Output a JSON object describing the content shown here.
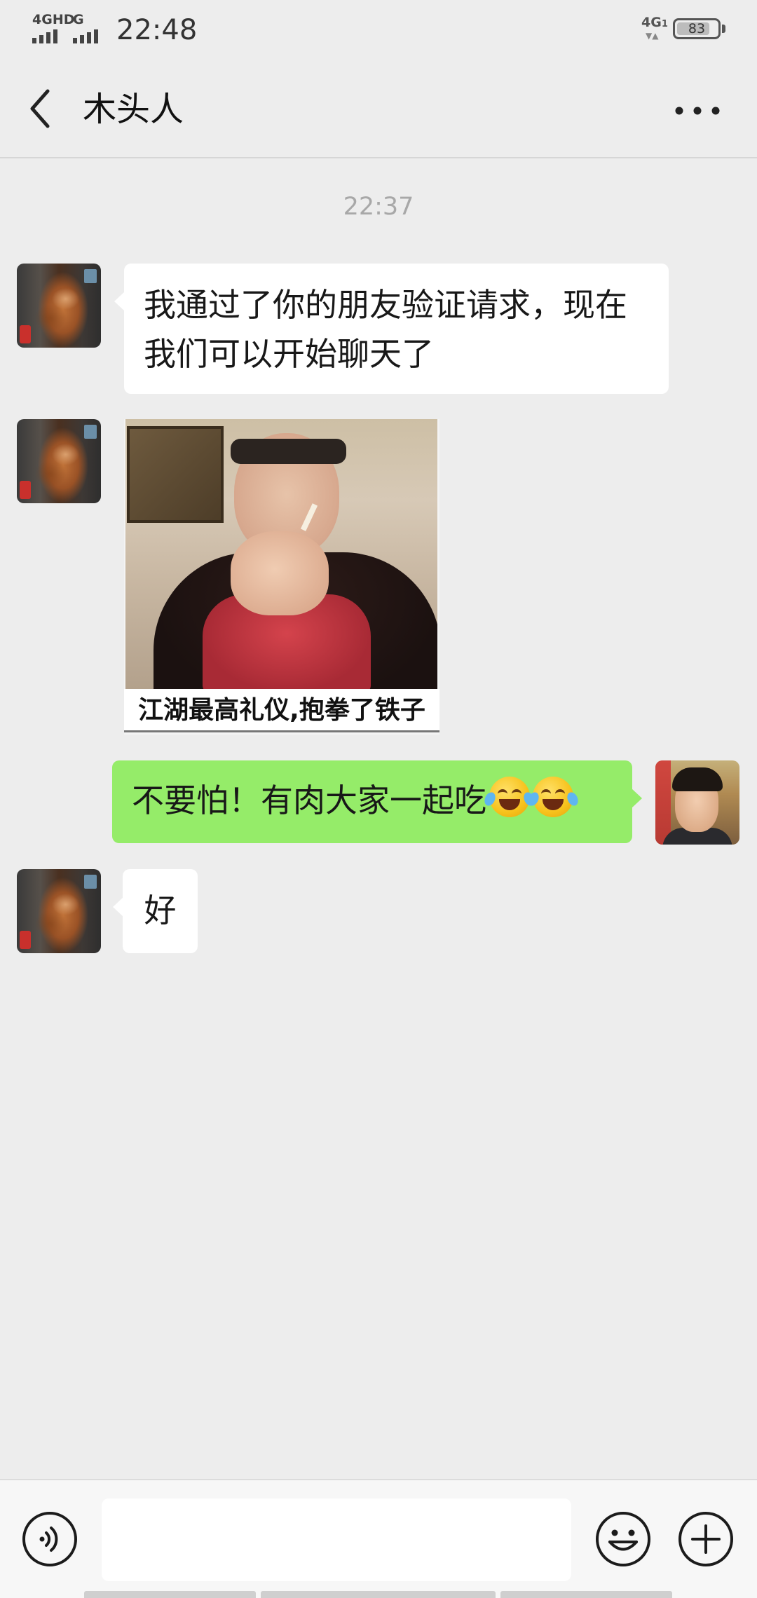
{
  "status_bar": {
    "network_label_1": "4GHD",
    "network_label_2": "G",
    "time": "22:48",
    "data_network": "4G",
    "data_sim": "1",
    "battery_percent": "83",
    "battery_level": 0.83
  },
  "header": {
    "back_icon": "chevron-left-icon",
    "title": "木头人",
    "more_icon": "more-horizontal-icon"
  },
  "conversation": {
    "timestamp": "22:37",
    "messages": [
      {
        "sender": "friend",
        "type": "text",
        "text": "我通过了你的朋友验证请求，现在我们可以开始聊天了"
      },
      {
        "sender": "friend",
        "type": "sticker",
        "caption": "江湖最高礼仪,抱拳了铁子"
      },
      {
        "sender": "me",
        "type": "text",
        "text": "不要怕！有肉大家一起吃",
        "emoji": [
          "laughing-crying-emoji",
          "laughing-crying-emoji"
        ]
      },
      {
        "sender": "friend",
        "type": "text",
        "text": "好"
      }
    ]
  },
  "input_bar": {
    "voice_icon": "voice-icon",
    "input_value": "",
    "emoji_icon": "smiley-icon",
    "plus_icon": "plus-circle-icon"
  },
  "colors": {
    "background": "#ededed",
    "incoming_bubble": "#ffffff",
    "outgoing_bubble": "#95ec69",
    "timestamp": "#a8a8a8",
    "input_bar": "#f7f7f7"
  }
}
